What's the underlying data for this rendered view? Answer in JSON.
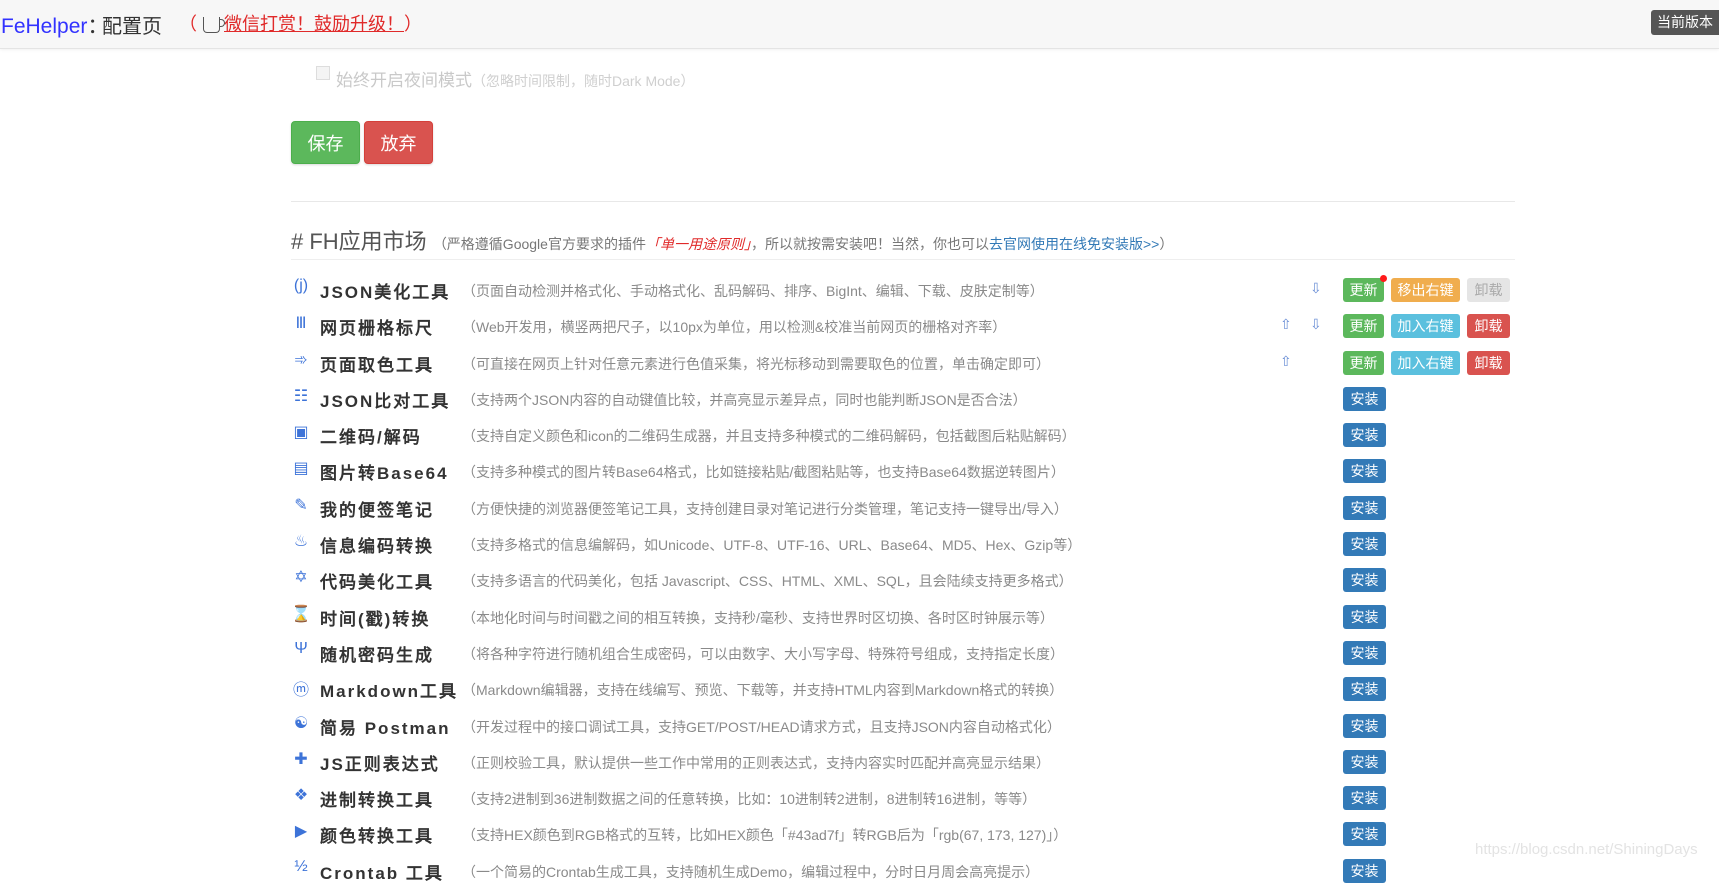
{
  "header": {
    "brand": "FeHelper",
    "separator": "：",
    "page_name": "配置页",
    "donate_open": "（",
    "donate_text": "微信打赏！鼓励升级！",
    "donate_close": "）",
    "version_badge": "当前版本"
  },
  "settings": {
    "night_mode_label": "始终开启夜间模式",
    "night_mode_hint": "（忽略时间限制，随时Dark Mode）",
    "night_mode_checked": false
  },
  "actions": {
    "save_label": "保存",
    "discard_label": "放弃"
  },
  "market": {
    "title": "# FH应用市场",
    "desc_prefix": "（严格遵循Google官方要求的插件",
    "desc_principle": "「单一用途原则」",
    "desc_middle": "，所以就按需安装吧！当然，你也可以",
    "desc_link": "去官网使用在线免安装版>>",
    "desc_suffix": "）"
  },
  "button_labels": {
    "update": "更新",
    "remove_ctx": "移出右键",
    "add_ctx": "加入右键",
    "uninstall": "卸载",
    "install": "安装"
  },
  "tools": [
    {
      "icon": "json-icon",
      "glyph": "(j)",
      "name": "JSON美化工具",
      "desc": "（页面自动检测并格式化、手动格式化、乱码解码、排序、BigInt、编辑、下载、皮肤定制等）"
    },
    {
      "icon": "ruler-grid-icon",
      "glyph": "Ⅲ",
      "name": "网页栅格标尺",
      "desc": "（Web开发用，横竖两把尺子，以10px为单位，用以检测&校准当前网页的栅格对齐率）"
    },
    {
      "icon": "color-picker-icon",
      "glyph": "➾",
      "name": "页面取色工具",
      "desc": "（可直接在网页上针对任意元素进行色值采集，将光标移动到需要取色的位置，单击确定即可）"
    },
    {
      "icon": "compare-list-icon",
      "glyph": "☷",
      "name": "JSON比对工具",
      "desc": "（支持两个JSON内容的自动键值比较，并高亮显示差异点，同时也能判断JSON是否合法）"
    },
    {
      "icon": "qrcode-icon",
      "glyph": "▣",
      "name": "二维码/解码",
      "desc": "（支持自定义颜色和icon的二维码生成器，并且支持多种模式的二维码解码，包括截图后粘贴解码）"
    },
    {
      "icon": "image-icon",
      "glyph": "▤",
      "name": "图片转Base64",
      "desc": "（支持多种模式的图片转Base64格式，比如链接粘贴/截图粘贴等，也支持Base64数据逆转图片）"
    },
    {
      "icon": "pencil-icon",
      "glyph": "✎",
      "name": "我的便签笔记",
      "desc": "（方便快捷的浏览器便签笔记工具，支持创建目录对笔记进行分类管理，笔记支持一键导出/导入）"
    },
    {
      "icon": "encode-icon",
      "glyph": "♨",
      "name": "信息编码转换",
      "desc": "（支持多格式的信息编解码，如Unicode、UTF-8、UTF-16、URL、Base64、MD5、Hex、Gzip等）"
    },
    {
      "icon": "star-of-david-icon",
      "glyph": "✡",
      "name": "代码美化工具",
      "desc": "（支持多语言的代码美化，包括 Javascript、CSS、HTML、XML、SQL，且会陆续支持更多格式）"
    },
    {
      "icon": "hourglass-icon",
      "glyph": "⌛",
      "name": "时间(戳)转换",
      "desc": "（本地化时间与时间戳之间的相互转换，支持秒/毫秒、支持世界时区切换、各时区时钟展示等）"
    },
    {
      "icon": "trident-icon",
      "glyph": "Ψ",
      "name": "随机密码生成",
      "desc": "（将各种字符进行随机组合生成密码，可以由数字、大小写字母、特殊符号组成，支持指定长度）"
    },
    {
      "icon": "markdown-icon",
      "glyph": "ⓜ",
      "name": "Markdown工具",
      "desc": "（Markdown编辑器，支持在线编写、预览、下载等，并支持HTML内容到Markdown格式的转换）"
    },
    {
      "icon": "yin-yang-icon",
      "glyph": "☯",
      "name": "简易 Postman",
      "desc": "（开发过程中的接口调试工具，支持GET/POST/HEAD请求方式，且支持JSON内容自动格式化）"
    },
    {
      "icon": "plus-icon",
      "glyph": "✚",
      "name": "JS正则表达式",
      "desc": "（正则校验工具，默认提供一些工作中常用的正则表达式，支持内容实时匹配并高亮显示结果）"
    },
    {
      "icon": "diamond-grid-icon",
      "glyph": "❖",
      "name": "进制转换工具",
      "desc": "（支持2进制到36进制数据之间的任意转换，比如：10进制转2进制，8进制转16进制，等等）"
    },
    {
      "icon": "play-icon",
      "glyph": "▶",
      "name": "颜色转换工具",
      "desc": "（支持HEX颜色到RGB格式的互转，比如HEX颜色「#43ad7f」转RGB后为「rgb(67, 173, 127)」）"
    },
    {
      "icon": "fraction-icon",
      "glyph": "½",
      "name": "Crontab 工具",
      "desc": "（一个简易的Crontab生成工具，支持随机生成Demo，编辑过程中，分时日月周会高亮提示）"
    }
  ],
  "watermark": "https://blog.csdn.net/ShiningDays"
}
